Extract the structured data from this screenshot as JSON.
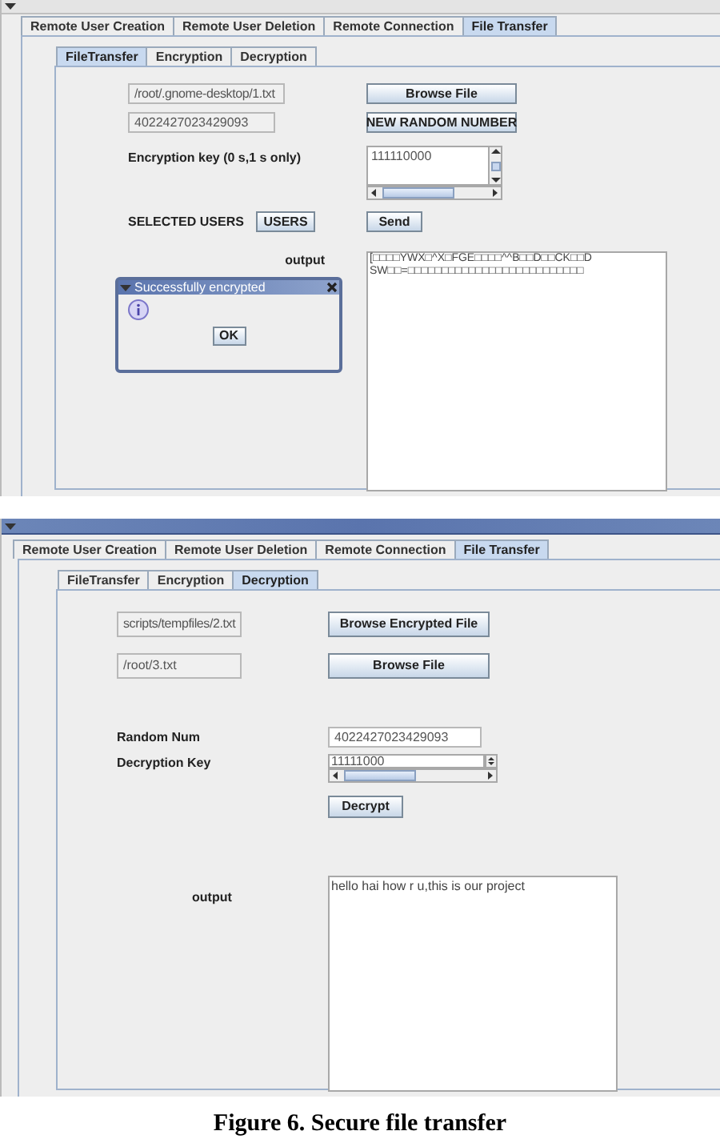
{
  "screens": [
    {
      "kind": "encryption",
      "title_bar": {
        "active": false
      },
      "outer_tabs": [
        {
          "label": "Remote User Creation",
          "selected": false
        },
        {
          "label": "Remote User Deletion",
          "selected": false
        },
        {
          "label": "Remote Connection",
          "selected": false
        },
        {
          "label": "File Transfer",
          "selected": true
        }
      ],
      "inner_tabs": [
        {
          "label": "FileTransfer",
          "selected": true
        },
        {
          "label": "Encryption",
          "selected": false
        },
        {
          "label": "Decryption",
          "selected": false
        }
      ],
      "file_path": "/root/.gnome-desktop/1.txt",
      "browse_button": "Browse File",
      "random_number": "4022427023429093",
      "random_button": "NEW RANDOM NUMBER",
      "key_label": "Encryption key (0 s,1 s only)",
      "key_value": "111110000",
      "users_label": "SELECTED USERS",
      "users_button": "USERS",
      "send_button": "Send",
      "output_label": "output",
      "output_lines": [
        "[□□□□YWX□^X□FGE□□□□^^B□□D□□CK□□D",
        "SW□□=□□□□□□□□□□□□□□□□□□□□□□□□□□"
      ],
      "dialog": {
        "title": "Successfully encrypted",
        "button": "OK"
      }
    },
    {
      "kind": "decryption",
      "title_bar": {
        "active": true
      },
      "outer_tabs": [
        {
          "label": "Remote User Creation",
          "selected": false
        },
        {
          "label": "Remote User Deletion",
          "selected": false
        },
        {
          "label": "Remote Connection",
          "selected": false
        },
        {
          "label": "File Transfer",
          "selected": true
        }
      ],
      "inner_tabs": [
        {
          "label": "FileTransfer",
          "selected": false
        },
        {
          "label": "Encryption",
          "selected": false
        },
        {
          "label": "Decryption",
          "selected": true
        }
      ],
      "encrypted_path": "scripts/tempfiles/2.txt",
      "browse_encrypted_button": "Browse Encrypted  File",
      "file_path": "/root/3.txt",
      "browse_button": "Browse File",
      "random_label": "Random Num",
      "random_value": "4022427023429093",
      "key_label": "Decryption Key",
      "key_value": "11111000",
      "decrypt_button": "Decrypt",
      "output_label": "output",
      "output_text": "hello hai how r u,this is our project"
    }
  ],
  "caption": "Figure 6. Secure file transfer"
}
